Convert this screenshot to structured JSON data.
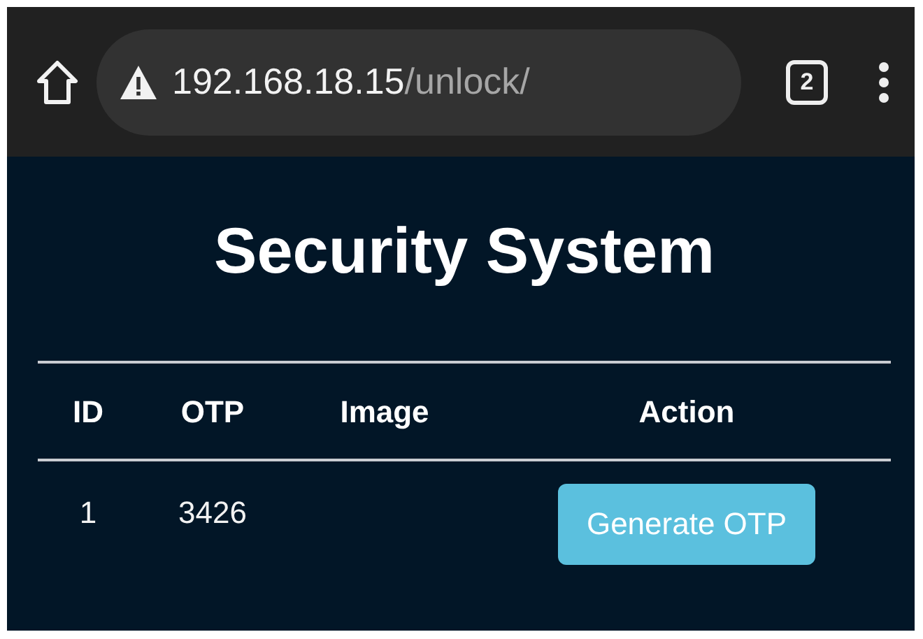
{
  "browser": {
    "url_host": "192.168.18.15",
    "url_path": "/unlock/",
    "tab_count": "2"
  },
  "page": {
    "title": "Security System"
  },
  "table": {
    "columns": [
      "ID",
      "OTP",
      "Image",
      "Action"
    ],
    "rows": [
      {
        "id": "1",
        "otp": "3426",
        "action": "Generate OTP"
      }
    ]
  }
}
